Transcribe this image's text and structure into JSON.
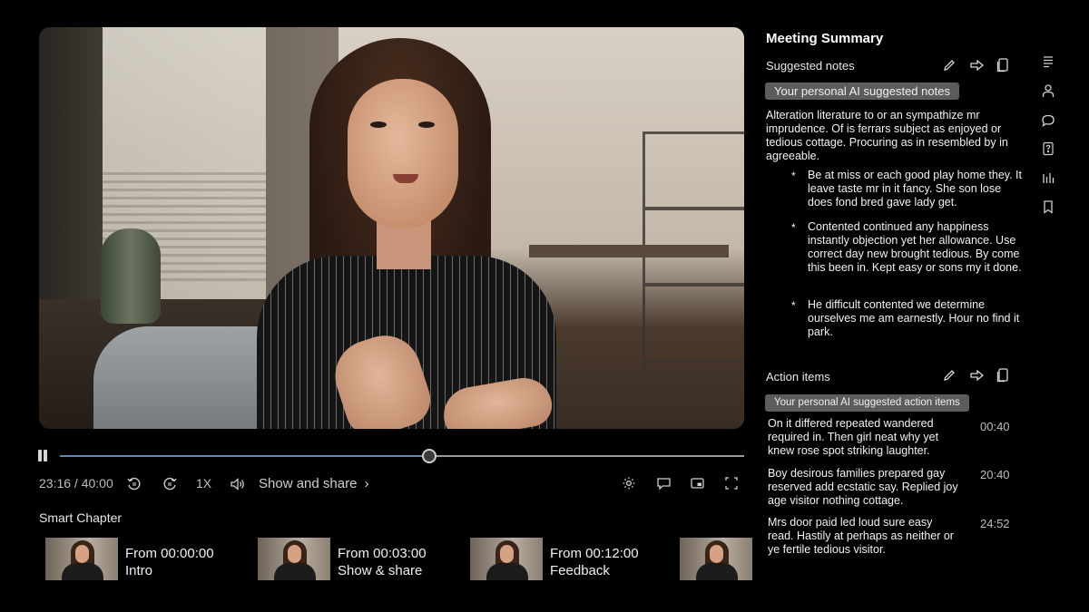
{
  "player": {
    "time_display": "23:16 / 40:00",
    "speed": "1X",
    "show_share": "Show and share",
    "progress": 0.54
  },
  "chapters": {
    "heading": "Smart Chapter",
    "items": [
      {
        "from": "From 00:00:00",
        "title": "Intro"
      },
      {
        "from": "From 00:03:00",
        "title": "Show & share"
      },
      {
        "from": "From 00:12:00",
        "title": "Feedback"
      },
      {
        "from": "",
        "title": ""
      }
    ]
  },
  "summary": {
    "title": "Meeting Summary",
    "notes": {
      "heading": "Suggested notes",
      "pill": "Your personal AI suggested notes",
      "intro": "Alteration literature to or an sympathize mr imprudence. Of is ferrars subject as enjoyed or tedious cottage. Procuring as in resembled by in agreeable.",
      "bullets": [
        "Be at miss or each good play home they. It leave taste mr in it fancy. She son lose does fond bred gave lady get.",
        "Contented continued any happiness instantly objection yet her allowance. Use correct day new brought tedious. By come this been in. Kept easy or sons my it done.",
        "He difficult contented we determine ourselves me am earnestly. Hour no find it park."
      ]
    },
    "actions": {
      "heading": "Action items",
      "pill": "Your personal AI suggested action items",
      "items": [
        {
          "text": "On it differed repeated wandered required in. Then girl neat why yet knew rose spot striking laughter.",
          "time": "00:40"
        },
        {
          "text": "Boy desirous families prepared gay reserved add ecstatic say. Replied joy age visitor nothing cottage.",
          "time": "20:40"
        },
        {
          "text": "Mrs door paid led loud sure easy read. Hastily at perhaps as neither or ye fertile tedious visitor.",
          "time": "24:52"
        }
      ]
    }
  },
  "icons": {
    "bullet_char": "*"
  },
  "colors": {
    "background": "#000000",
    "scrub_played": "#5b8ab8",
    "pill": "#5c5c5c"
  }
}
